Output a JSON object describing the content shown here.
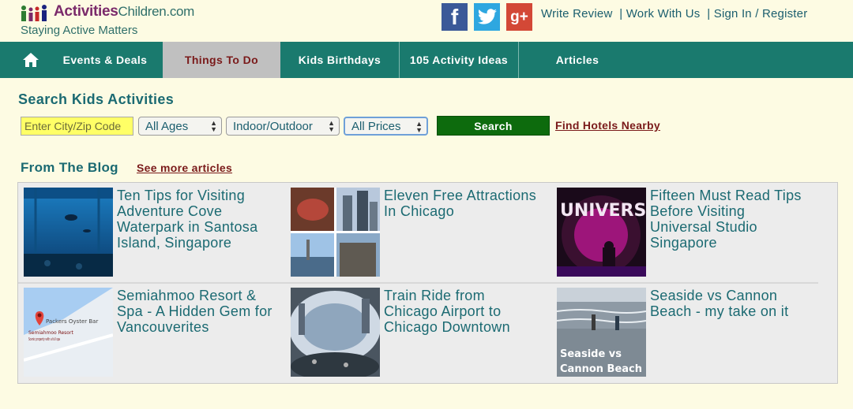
{
  "header": {
    "logo_text_activities": "Activities",
    "logo_text_children": "Children.com",
    "logo_tagline": "Staying Active Matters",
    "social": {
      "facebook": "f",
      "twitter": "t",
      "googleplus": "g+"
    },
    "links": {
      "write_review": "Write Review",
      "work_with_us": "Work With Us",
      "sign_in": "Sign In / Register",
      "separator": "|"
    }
  },
  "nav": {
    "items": [
      {
        "label": "Events & Deals"
      },
      {
        "label": "Things To Do"
      },
      {
        "label": "Kids Birthdays"
      },
      {
        "label": "105 Activity Ideas"
      },
      {
        "label": "Articles"
      }
    ],
    "active": "Things To Do"
  },
  "search": {
    "title": "Search Kids Activities",
    "city_placeholder": "Enter City/Zip Code",
    "ages": "All Ages",
    "setting": "Indoor/Outdoor",
    "prices": "All Prices",
    "button": "Search",
    "hotels_link": "Find Hotels Nearby"
  },
  "blog": {
    "title": "From The Blog",
    "see_more": "See more articles",
    "articles": [
      {
        "title": "Ten Tips for Visiting Adventure Cove Waterpark in Santosa Island, Singapore"
      },
      {
        "title": "Eleven Free Attractions In Chicago"
      },
      {
        "title": "Fifteen Must Read Tips Before Visiting Universal Studio Singapore"
      },
      {
        "title": "Semiahmoo Resort & Spa - A Hidden Gem for Vancouverites",
        "map_place": "Packers Oyster Bar",
        "map_pin": "Semiahmoo Resort",
        "map_note": "Scenic property with a full spa"
      },
      {
        "title": "Train Ride from Chicago Airport to Chicago Downtown"
      },
      {
        "title": "Seaside vs Cannon Beach - my take on it",
        "overlay": "Seaside vs Cannon Beach"
      }
    ],
    "universal_sign": "UNIVERS"
  }
}
